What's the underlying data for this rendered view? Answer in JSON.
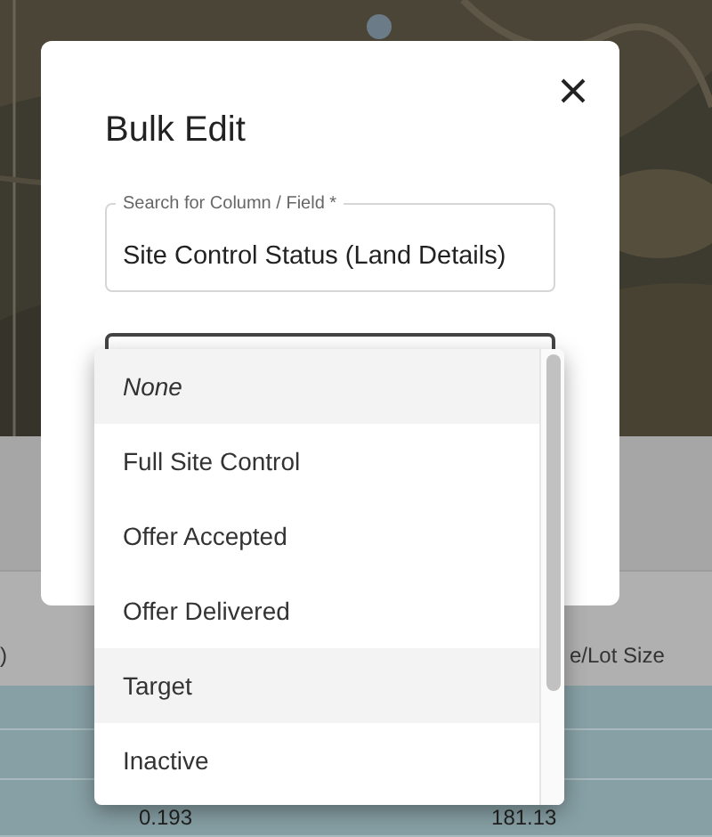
{
  "background": {
    "table": {
      "headers": [
        ")",
        "e/Lot Size"
      ],
      "rows": [
        {
          "cells": [
            "0.193",
            "181.13"
          ]
        }
      ]
    }
  },
  "dialog": {
    "title": "Bulk Edit",
    "field": {
      "label": "Search for Column / Field *",
      "value": "Site Control Status (Land Details)"
    },
    "dropdown": {
      "options": [
        {
          "label": "None",
          "kind": "placeholder",
          "highlighted": true
        },
        {
          "label": "Full Site Control",
          "kind": "option",
          "highlighted": false
        },
        {
          "label": "Offer Accepted",
          "kind": "option",
          "highlighted": false
        },
        {
          "label": "Offer Delivered",
          "kind": "option",
          "highlighted": false
        },
        {
          "label": "Target",
          "kind": "option",
          "highlighted": true
        },
        {
          "label": "Inactive",
          "kind": "option",
          "highlighted": false
        }
      ]
    }
  }
}
